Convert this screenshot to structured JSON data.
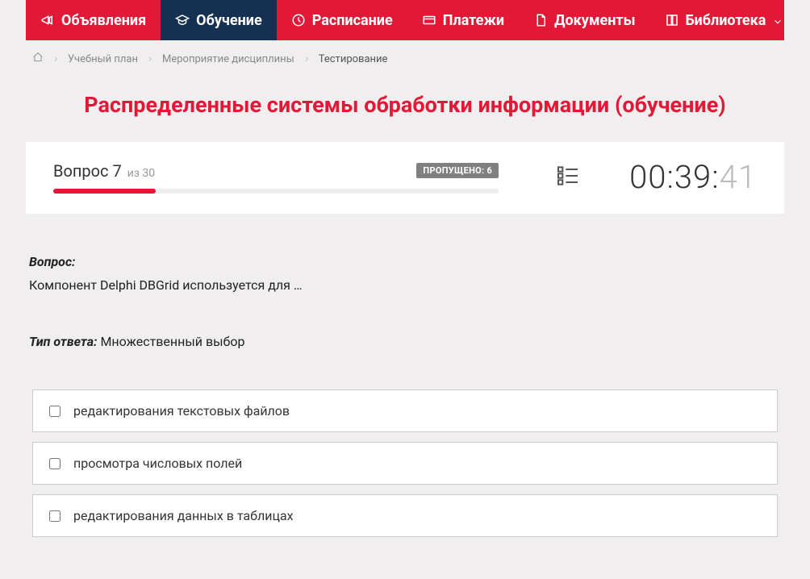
{
  "nav": {
    "items": [
      {
        "label": "Объявления",
        "icon": "megaphone",
        "active": false
      },
      {
        "label": "Обучение",
        "icon": "graduation",
        "active": true
      },
      {
        "label": "Расписание",
        "icon": "clock",
        "active": false
      },
      {
        "label": "Платежи",
        "icon": "card",
        "active": false
      },
      {
        "label": "Документы",
        "icon": "document",
        "active": false
      },
      {
        "label": "Библиотека",
        "icon": "book",
        "active": false,
        "dropdown": true
      }
    ]
  },
  "breadcrumbs": {
    "items": [
      {
        "label": "Учебный план"
      },
      {
        "label": "Мероприятие дисциплины"
      }
    ],
    "current": "Тестирование"
  },
  "page": {
    "title": "Распределенные системы обработки информации (обучение)"
  },
  "status": {
    "question_word": "Вопрос",
    "question_num": "7",
    "of_word": "из",
    "total": "30",
    "skipped_label": "ПРОПУЩЕНО: 6",
    "progress_percent": 23,
    "timer_main": "00:39:",
    "timer_seconds": "41"
  },
  "question": {
    "label": "Вопрос:",
    "text": "Компонент Delphi DBGrid используется для …",
    "answer_type_label": "Тип ответа:",
    "answer_type_value": "Множественный выбор",
    "options": [
      {
        "text": "редактирования текстовых файлов"
      },
      {
        "text": "просмотра числовых полей"
      },
      {
        "text": "редактирования данных в таблицах"
      }
    ]
  }
}
